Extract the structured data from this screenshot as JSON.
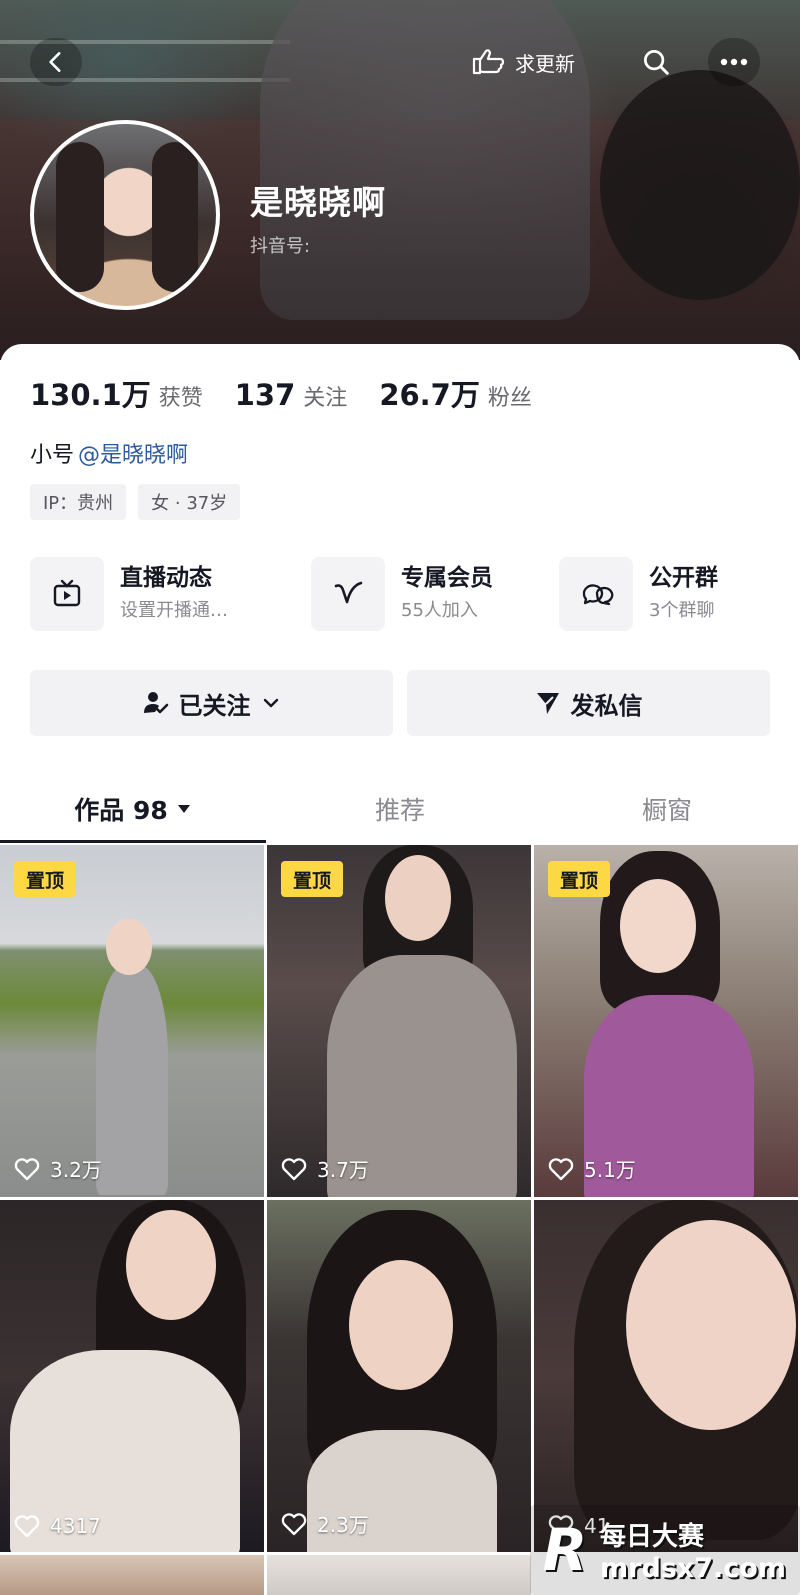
{
  "header": {
    "request_update_label": "求更新",
    "nickname": "是晓晓啊",
    "douyin_id_label": "抖音号:"
  },
  "stats": [
    {
      "value": "130.1万",
      "label": "获赞"
    },
    {
      "value": "137",
      "label": "关注"
    },
    {
      "value": "26.7万",
      "label": "粉丝"
    }
  ],
  "alt_account": {
    "prefix": "小号",
    "link": "@是晓晓啊"
  },
  "tags": [
    "IP：贵州",
    "女 · 37岁"
  ],
  "features": [
    {
      "icon": "tv-icon",
      "title": "直播动态",
      "subtitle": "设置开播通…"
    },
    {
      "icon": "v-icon",
      "title": "专属会员",
      "subtitle": "55人加入"
    },
    {
      "icon": "chat-bubbles-icon",
      "title": "公开群",
      "subtitle": "3个群聊"
    }
  ],
  "actions": {
    "following": "已关注",
    "message": "发私信"
  },
  "tabs": [
    {
      "label": "作品 98",
      "active": true
    },
    {
      "label": "推荐",
      "active": false
    },
    {
      "label": "橱窗",
      "active": false
    }
  ],
  "videos": [
    {
      "pinned": true,
      "pin_label": "置顶",
      "likes": "3.2万"
    },
    {
      "pinned": true,
      "pin_label": "置顶",
      "likes": "3.7万"
    },
    {
      "pinned": true,
      "pin_label": "置顶",
      "likes": "5.1万"
    },
    {
      "pinned": false,
      "likes": "4317"
    },
    {
      "pinned": false,
      "likes": "2.3万"
    },
    {
      "pinned": false,
      "likes": "41"
    }
  ],
  "watermark": {
    "logo": "R",
    "text_cn": "每日大赛",
    "url": "mrdsx7.com"
  },
  "colors": {
    "accent_pin": "#fdd845",
    "link": "#2d5a9b",
    "text": "#161823",
    "muted": "#8a8a90"
  }
}
